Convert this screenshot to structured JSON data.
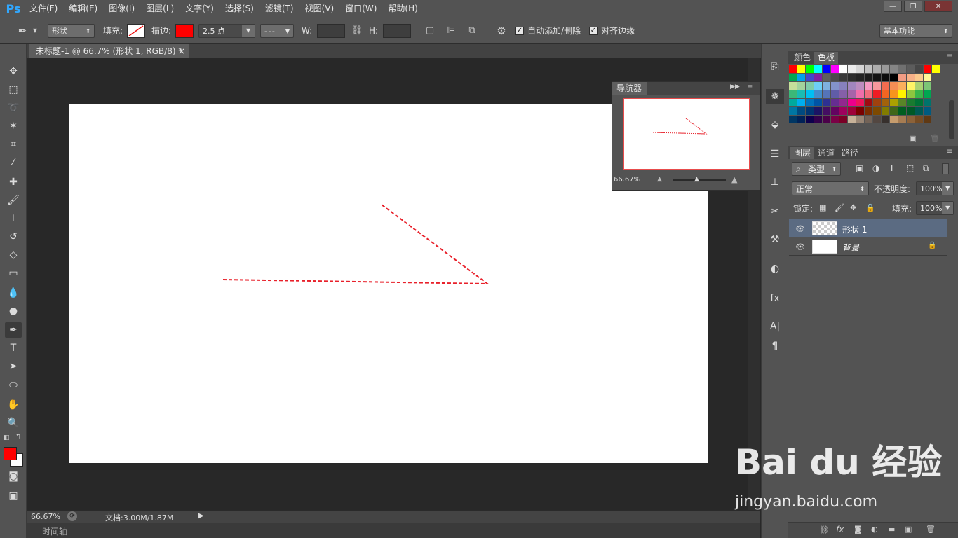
{
  "app": {
    "logo": "Ps"
  },
  "menu": [
    "文件(F)",
    "编辑(E)",
    "图像(I)",
    "图层(L)",
    "文字(Y)",
    "选择(S)",
    "滤镜(T)",
    "视图(V)",
    "窗口(W)",
    "帮助(H)"
  ],
  "window_controls": {
    "minimize": "—",
    "restore": "❐",
    "close": "✕"
  },
  "options": {
    "shape_mode": "形状",
    "fill_label": "填充:",
    "stroke_label": "描边:",
    "stroke_width": "2.5 点",
    "w_label": "W:",
    "h_label": "H:",
    "auto_add_delete": "自动添加/删除",
    "align_edges": "对齐边缘",
    "workspace": "基本功能",
    "stroke_color": "#ff0000"
  },
  "document": {
    "tab_title": "未标题-1 @ 66.7% (形状 1, RGB/8) *",
    "tab_close": "×"
  },
  "status": {
    "zoom": "66.67%",
    "doc_size": "文档:3.00M/1.87M",
    "timeline": "时间轴"
  },
  "navigator": {
    "title": "导航器",
    "zoom": "66.67%"
  },
  "swatches_panel": {
    "tabs": [
      "颜色",
      "色板"
    ],
    "rows": [
      [
        "#ff0000",
        "#ffff00",
        "#00ff00",
        "#00ffff",
        "#0000ff",
        "#ff00ff",
        "#ffffff",
        "#ebebeb",
        "#d6d6d6",
        "#c2c2c2",
        "#adadad",
        "#999999",
        "#858585",
        "#707070",
        "#5c5c5c",
        "#474747",
        "#ff0000",
        "#ffff00"
      ],
      [
        "#00a650",
        "#00a2e8",
        "#3f48cc",
        "#7f1fa5",
        "#5e5e5e",
        "#4a4a4a",
        "#3a3a3a",
        "#2d2d2d",
        "#242424",
        "#1c1c1c",
        "#141414",
        "#0c0c0c",
        "#000000",
        "#f29c84",
        "#f7b087",
        "#fbc98d",
        "#fff799"
      ],
      [
        "#c6df9a",
        "#a3d39c",
        "#7fcca9",
        "#6dcff6",
        "#7eb1df",
        "#8393ca",
        "#8781bd",
        "#a186be",
        "#bc8dbf",
        "#f49ac2",
        "#f6989d",
        "#f26c4f",
        "#f68e55",
        "#fbaf5c",
        "#fff467",
        "#acd372",
        "#7cc576"
      ],
      [
        "#3bb878",
        "#1abbb4",
        "#00bff3",
        "#438ccb",
        "#5574b9",
        "#605ca8",
        "#855fa8",
        "#a763a9",
        "#f06eaa",
        "#f26d7d",
        "#ed1c24",
        "#f26522",
        "#f7941d",
        "#fff200",
        "#8dc63f",
        "#39b54a",
        "#00a651"
      ],
      [
        "#00a99d",
        "#00aeef",
        "#0072bc",
        "#0054a5",
        "#2e3192",
        "#662d91",
        "#92278f",
        "#ec008c",
        "#ed145b",
        "#9e0b0f",
        "#a0410d",
        "#a3620a",
        "#aba000",
        "#598527",
        "#197b30",
        "#007236",
        "#00746b"
      ],
      [
        "#0076a3",
        "#004a80",
        "#003471",
        "#1b1464",
        "#440e62",
        "#630460",
        "#9e005d",
        "#9e0039",
        "#790000",
        "#7b2e00",
        "#7d4900",
        "#827b00",
        "#406618",
        "#005e20",
        "#005826",
        "#005952",
        "#005b7f"
      ],
      [
        "#003663",
        "#002157",
        "#0d004c",
        "#32004b",
        "#4b0049",
        "#7b0046",
        "#7a0026",
        "#c7b299",
        "#998675",
        "#736357",
        "#534741",
        "#37302d",
        "#c69c6d",
        "#a67c52",
        "#8c6239",
        "#754c24",
        "#603913"
      ]
    ]
  },
  "layers_panel": {
    "tabs": [
      "图层",
      "通道",
      "路径"
    ],
    "filter_kind": "类型",
    "blend_mode": "正常",
    "opacity_label": "不透明度:",
    "opacity_value": "100%",
    "lock_label": "锁定:",
    "fill_label": "填充:",
    "fill_value": "100%",
    "layers": [
      {
        "name": "形状 1",
        "selected": true
      },
      {
        "name": "背景",
        "locked": true
      }
    ]
  },
  "watermark": {
    "logo": "Bai du 经验",
    "url": "jingyan.baidu.com"
  }
}
